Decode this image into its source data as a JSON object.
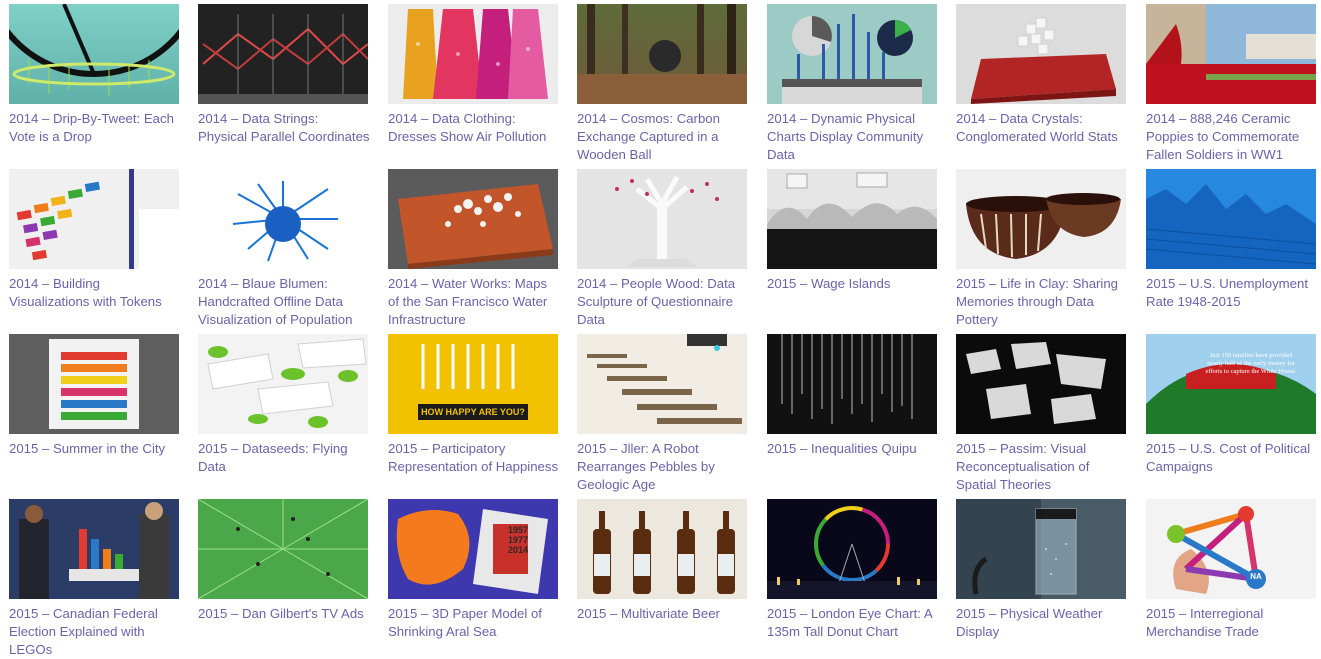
{
  "items": [
    {
      "caption": "2014 – Drip-By-Tweet: Each Vote is a Drop",
      "icon": "drip-by-tweet-thumbnail",
      "bg": "#7fd1c8"
    },
    {
      "caption": "2014 – Data Strings: Physical Parallel Coordinates",
      "icon": "data-strings-thumbnail",
      "bg": "#1e1e1e"
    },
    {
      "caption": "2014 – Data Clothing: Dresses Show Air Pollution",
      "icon": "data-clothing-thumbnail",
      "bg": "#e9e9e9"
    },
    {
      "caption": "2014 – Cosmos: Carbon Exchange Captured in a Wooden Ball",
      "icon": "cosmos-thumbnail",
      "bg": "#4a5a2e"
    },
    {
      "caption": "2014 – Dynamic Physical Charts Display Community Data",
      "icon": "dynamic-charts-thumbnail",
      "bg": "#8fc1bc"
    },
    {
      "caption": "2014 – Data Crystals: Conglomerated World Stats",
      "icon": "data-crystals-thumbnail",
      "bg": "#d8d8d8"
    },
    {
      "caption": "2014 – 888,246 Ceramic Poppies to Commemorate Fallen Soldiers in WW1",
      "icon": "ceramic-poppies-thumbnail",
      "bg": "#8fb7d9"
    },
    {
      "caption": "2014 – Building Visualizations with Tokens",
      "icon": "tokens-thumbnail",
      "bg": "#f2f2f2"
    },
    {
      "caption": "2014 – Blaue Blumen: Handcrafted Offline Data Visualization of Population Density",
      "icon": "blaue-blumen-thumbnail",
      "bg": "#ffffff"
    },
    {
      "caption": "2014 – Water Works: Maps of the San Francisco Water Infrastructure",
      "icon": "water-works-thumbnail",
      "bg": "#5a5a5a"
    },
    {
      "caption": "2014 – People Wood: Data Sculpture of Questionnaire Data",
      "icon": "people-wood-thumbnail",
      "bg": "#e8e8e8"
    },
    {
      "caption": "2015 – Wage Islands",
      "icon": "wage-islands-thumbnail",
      "bg": "#cfcfcf"
    },
    {
      "caption": "2015 – Life in Clay: Sharing Memories through Data Pottery",
      "icon": "life-in-clay-thumbnail",
      "bg": "#f0f0f0"
    },
    {
      "caption": "2015 – U.S. Unemployment Rate 1948-2015",
      "icon": "unemployment-thumbnail",
      "bg": "#1f7fd8"
    },
    {
      "caption": "2015 – Summer in the City",
      "icon": "summer-city-thumbnail",
      "bg": "#e7e7e7"
    },
    {
      "caption": "2015 – Dataseeds: Flying Data",
      "icon": "dataseeds-thumbnail",
      "bg": "#f5f5f5"
    },
    {
      "caption": "2015 – Participatory Representation of Happiness",
      "icon": "happiness-thumbnail",
      "bg": "#f2c500",
      "text": "HOW HAPPY ARE YOU?"
    },
    {
      "caption": "2015 – Jller: A Robot Rearranges Pebbles by Geologic Age",
      "icon": "jller-thumbnail",
      "bg": "#efe9df"
    },
    {
      "caption": "2015 – Inequalities Quipu",
      "icon": "quipu-thumbnail",
      "bg": "#111111"
    },
    {
      "caption": "2015 – Passim: Visual Reconceptualisation of Spatial Theories",
      "icon": "passim-thumbnail",
      "bg": "#0d0d0d"
    },
    {
      "caption": "2015 – U.S. Cost of Political Campaigns",
      "icon": "political-campaigns-thumbnail",
      "bg": "#9fd0ee",
      "text": "Just 158 families have provided nearly half of the early money for efforts to capture the White House."
    },
    {
      "caption": "2015 – Canadian Federal Election Explained with LEGOs",
      "icon": "lego-election-thumbnail",
      "bg": "#263a6a"
    },
    {
      "caption": "2015 – Dan Gilbert's TV Ads",
      "icon": "tv-ads-thumbnail",
      "bg": "#4aa54a"
    },
    {
      "caption": "2015 – 3D Paper Model of Shrinking Aral Sea",
      "icon": "aral-sea-thumbnail",
      "bg": "#3a35a8",
      "text": "1957 1977 2014"
    },
    {
      "caption": "2015 – Multivariate Beer",
      "icon": "beer-thumbnail",
      "bg": "#ece8e0"
    },
    {
      "caption": "2015 – London Eye Chart: A 135m Tall Donut Chart",
      "icon": "london-eye-thumbnail",
      "bg": "#070712"
    },
    {
      "caption": "2015 – Physical Weather Display",
      "icon": "weather-display-thumbnail",
      "bg": "#2d3d4c"
    },
    {
      "caption": "2015 – Interregional Merchandise Trade",
      "icon": "merchandise-trade-thumbnail",
      "bg": "#f3f3f3",
      "text": "NA"
    }
  ]
}
